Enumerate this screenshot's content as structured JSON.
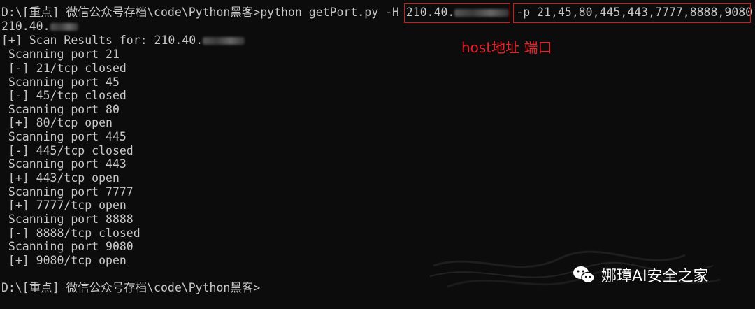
{
  "terminal": {
    "prompt": "D:\\[重点] 微信公众号存档\\code\\Python黑客>",
    "command": "python getPort.py ",
    "host_flag": "-H 210.40.",
    "port_flag": "-p 21,45,80,445,443,7777,8888,9080",
    "resolved_host": "210.40.",
    "scan_results_label": "[+] Scan Results for: 210.40.",
    "output_lines": [
      " Scanning port 21",
      " [-] 21/tcp closed",
      " Scanning port 45",
      " [-] 45/tcp closed",
      " Scanning port 80",
      " [+] 80/tcp open",
      " Scanning port 445",
      " [-] 445/tcp closed",
      " Scanning port 443",
      " [+] 443/tcp open",
      " Scanning port 7777",
      " [+] 7777/tcp open",
      " Scanning port 8888",
      " [-] 8888/tcp closed",
      " Scanning port 9080",
      " [+] 9080/tcp open"
    ],
    "final_prompt": "D:\\[重点] 微信公众号存档\\code\\Python黑客>"
  },
  "annotation": "host地址 端口",
  "watermark": {
    "icon": "wechat-icon",
    "text": "娜璋AI安全之家"
  },
  "colors": {
    "background": "#0c0c0c",
    "text": "#c8c8c8",
    "highlight": "#d11a1a",
    "annotation": "#e8212b"
  }
}
